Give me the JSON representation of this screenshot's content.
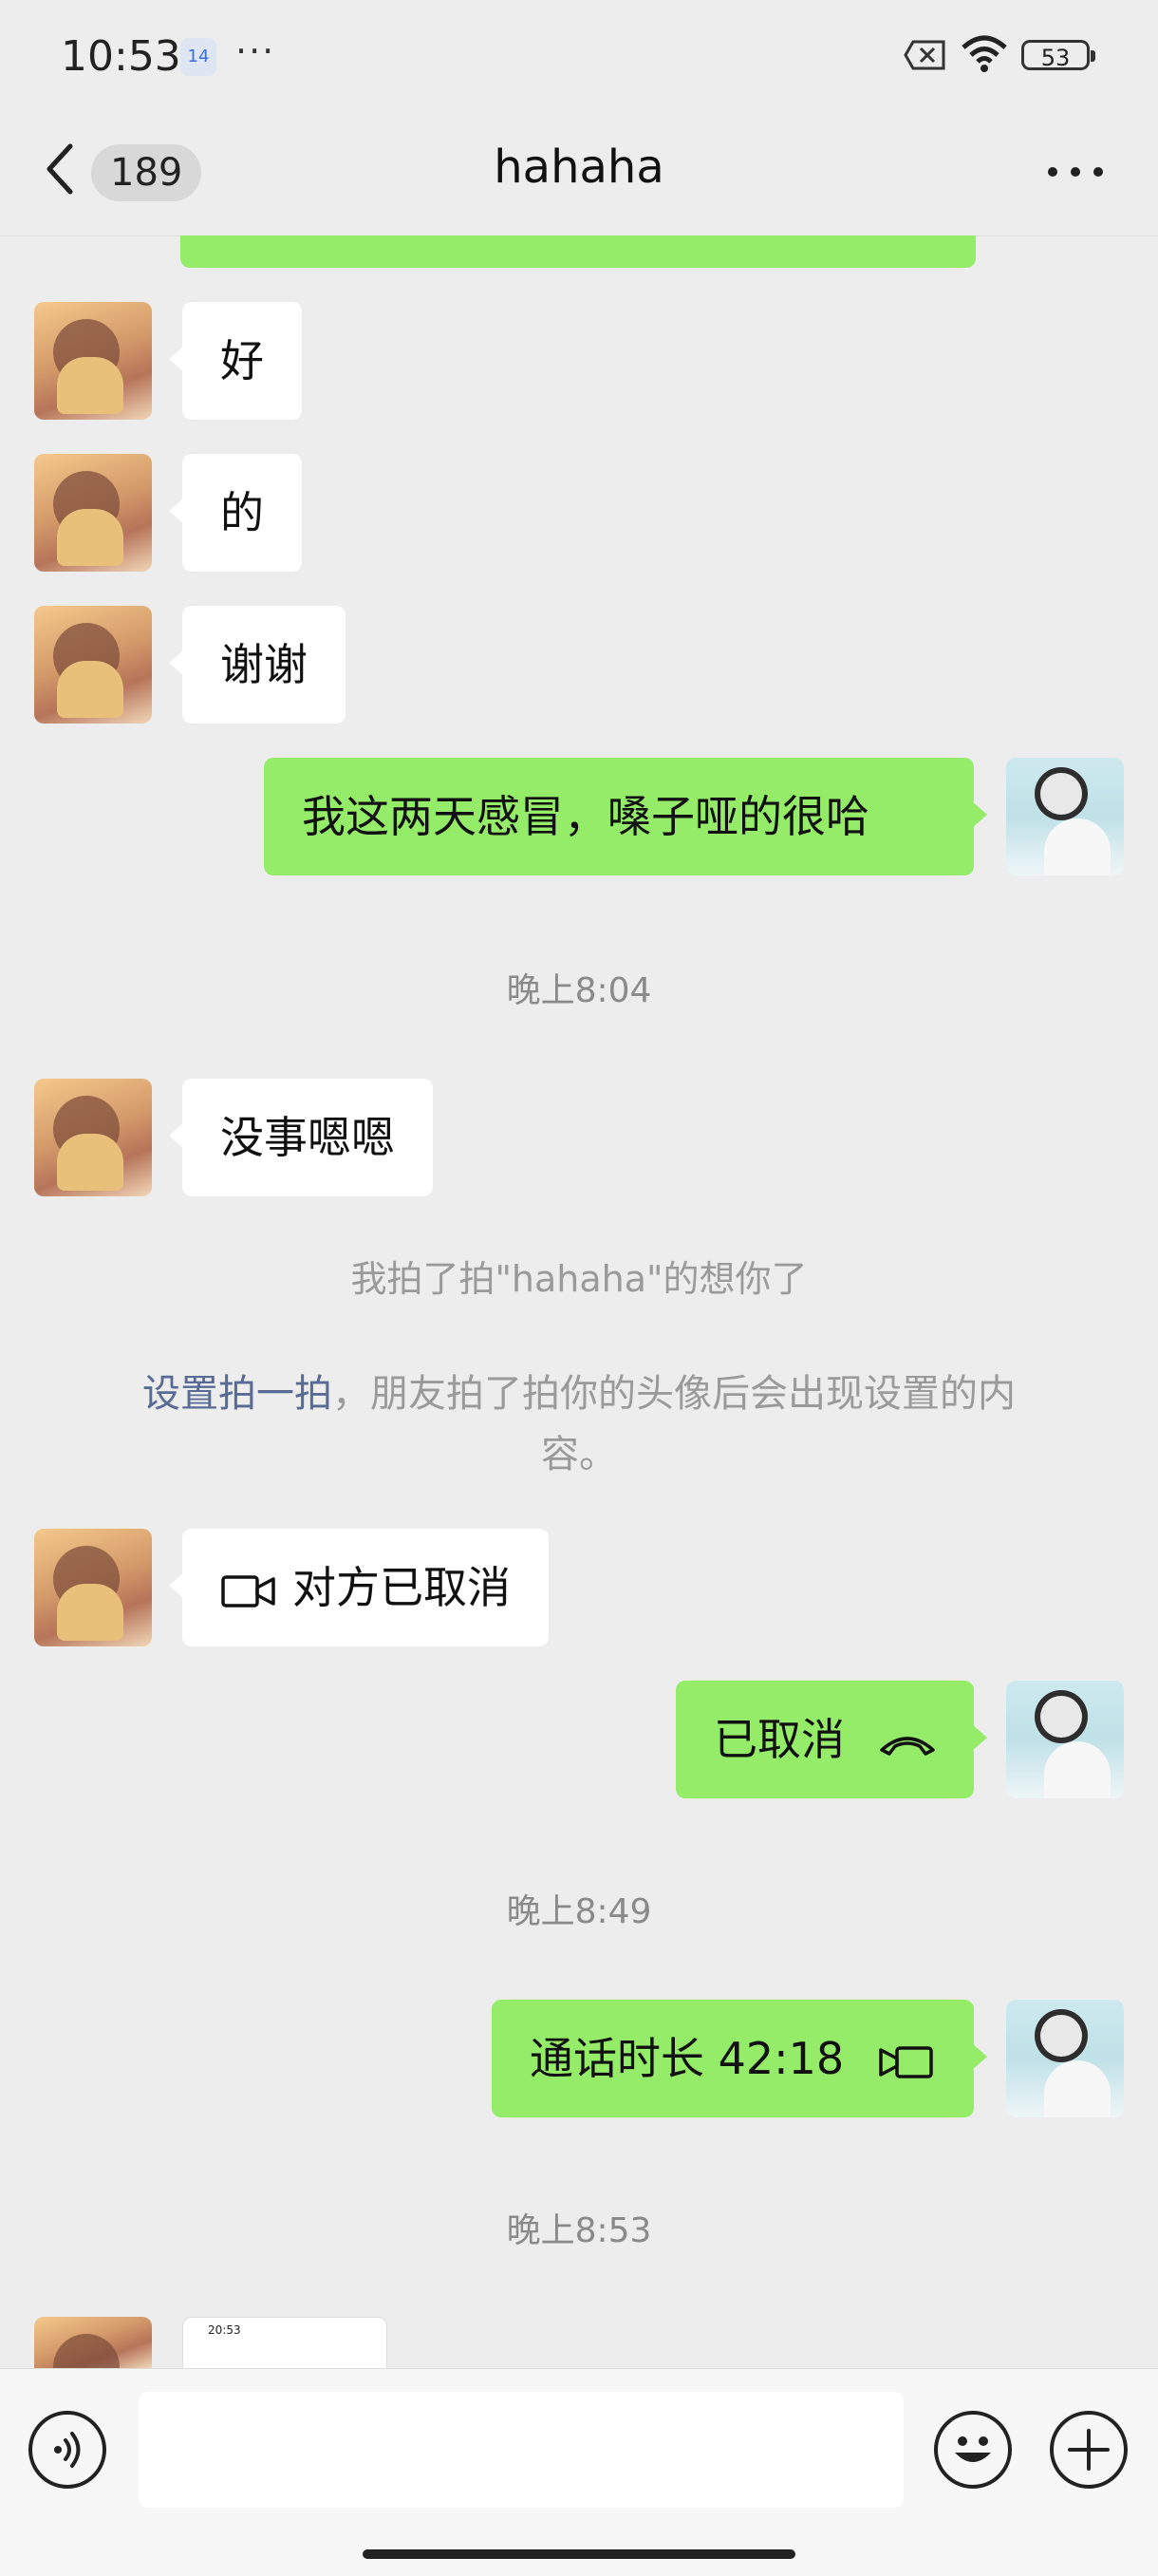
{
  "status_bar": {
    "time": "10:53",
    "notification_badge": "14",
    "battery": "53"
  },
  "header": {
    "unread_count": "189",
    "title": "hahaha"
  },
  "messages": [
    {
      "side": "in",
      "text": "好"
    },
    {
      "side": "in",
      "text": "的"
    },
    {
      "side": "in",
      "text": "谢谢"
    },
    {
      "side": "out",
      "text": "我这两天感冒，嗓子哑的很哈"
    },
    {
      "side": "in",
      "text": "没事嗯嗯"
    },
    {
      "side": "in",
      "text": "对方已取消",
      "icon": "video-call-icon"
    },
    {
      "side": "out",
      "text": "已取消",
      "icon": "hang-up-icon"
    },
    {
      "side": "out",
      "text": "通话时长 42:18",
      "icon": "video-call-icon"
    }
  ],
  "timestamps": [
    "晚上8:04",
    "晚上8:49",
    "晚上8:53"
  ],
  "pat_notice": "我拍了拍\"hahaha\"的想你了",
  "pat_tip": {
    "link": "设置拍一拍",
    "text_line1": "，朋友拍了拍你的头像后会出现设置的内",
    "text_line2": "容。"
  },
  "thumbnail": {
    "time": "20:53"
  },
  "colors": {
    "outgoing_bubble": "#95ec69",
    "incoming_bubble": "#ffffff",
    "background": "#ededed",
    "link": "#576b95"
  }
}
